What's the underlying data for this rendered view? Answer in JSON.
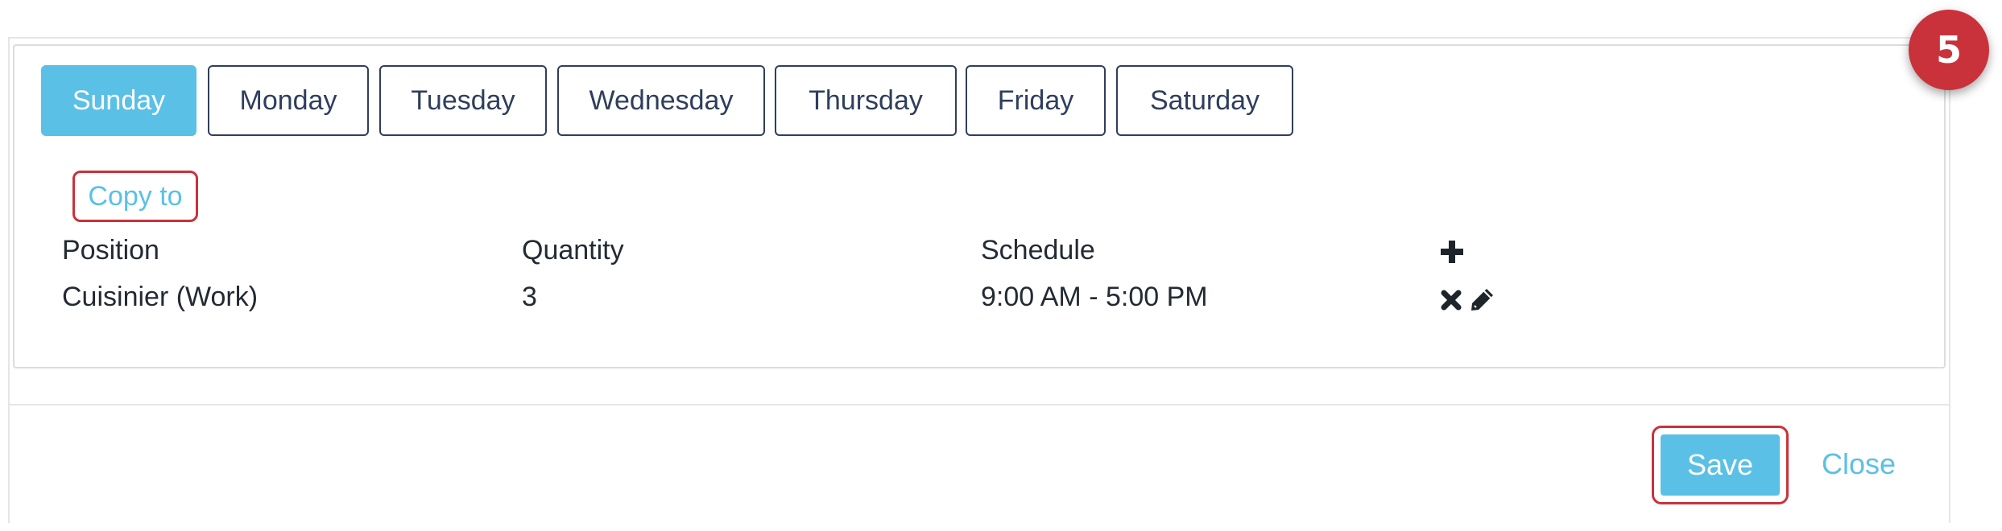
{
  "tabs": {
    "days": [
      "Sunday",
      "Monday",
      "Tuesday",
      "Wednesday",
      "Thursday",
      "Friday",
      "Saturday"
    ],
    "selected": "Sunday"
  },
  "copy_to_label": "Copy to",
  "table": {
    "headers": {
      "position": "Position",
      "quantity": "Quantity",
      "schedule": "Schedule"
    },
    "rows": [
      {
        "position": "Cuisinier (Work)",
        "quantity": "3",
        "schedule": "9:00 AM - 5:00 PM"
      }
    ]
  },
  "icons": {
    "add": "plus-icon",
    "delete": "x-icon",
    "edit": "pencil-icon"
  },
  "footer": {
    "save_label": "Save",
    "close_label": "Close"
  },
  "step_badge": "5",
  "colors": {
    "accent": "#5bc0e6",
    "tab_border": "#2f3e5c",
    "highlight": "#c9323a",
    "text": "#232a33"
  }
}
